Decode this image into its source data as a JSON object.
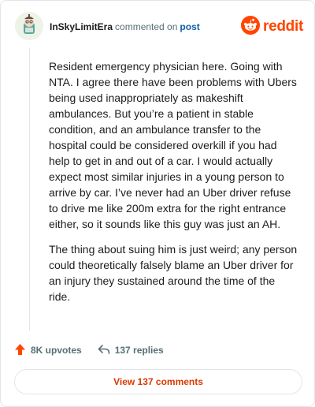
{
  "comment": {
    "username": "InSkyLimitEra",
    "action_text": "commented on",
    "target_link": "post",
    "paragraphs": [
      "Resident emergency physician here. Going with NTA. I agree there have been problems with Ubers being used inappropriately as makeshift ambulances. But you’re a patient in stable condition, and an ambulance transfer to the hospital could be considered overkill if you had help to get in and out of a car. I would actually expect most similar injuries in a young person to arrive by car. I’ve never had an Uber driver refuse to drive me like 200m extra for the right entrance either, so it sounds like this guy was just an AH.",
      "The thing about suing him is just weird; any person could theoretically falsely blame an Uber driver for an injury they sustained around the time of the ride."
    ]
  },
  "brand": {
    "wordmark": "reddit",
    "color": "#ff4500"
  },
  "stats": {
    "upvotes": "8K upvotes",
    "replies": "137 replies"
  },
  "footer": {
    "view_button": "View 137 comments"
  },
  "colors": {
    "upvote": "#ff4500",
    "link": "#0f5ea8",
    "muted": "#576f76",
    "button_text": "#d93900"
  },
  "icons": [
    "avatar",
    "reddit-snoo-icon",
    "upvote-arrow-icon",
    "reply-arrow-icon"
  ]
}
